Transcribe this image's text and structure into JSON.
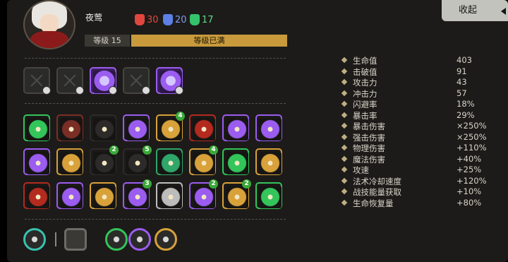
{
  "character": {
    "name": "夜莺"
  },
  "resources": [
    {
      "value": "30",
      "color": "#e0463e"
    },
    {
      "value": "20",
      "color": "#5d7fe6"
    },
    {
      "value": "17",
      "color": "#34c26a"
    }
  ],
  "level": {
    "label": "等级 15",
    "status": "等级已满",
    "progress": 1.0
  },
  "collapse_button": {
    "label": "收起"
  },
  "equipment": [
    {
      "icon": "empty-slot-icon",
      "accent": "#45443f",
      "state": "empty"
    },
    {
      "icon": "empty-slot-icon",
      "accent": "#45443f",
      "state": "empty"
    },
    {
      "icon": "purple-gem-mask-icon",
      "accent": "#9b5cf0",
      "state": "filled"
    },
    {
      "icon": "empty-slot-icon",
      "accent": "#45443f",
      "state": "empty"
    },
    {
      "icon": "armor-vest-icon",
      "accent": "#9b5cf0",
      "state": "filled"
    }
  ],
  "talents": [
    {
      "icon": "starburst-icon",
      "accent": "#33c55a",
      "badge": ""
    },
    {
      "icon": "winged-demon-icon",
      "accent": "#7a2e26",
      "badge": ""
    },
    {
      "icon": "mortar-icon",
      "accent": "#2c2b29",
      "badge": ""
    },
    {
      "icon": "purple-spikes-icon",
      "accent": "#9b5cf0",
      "badge": ""
    },
    {
      "icon": "lightning-tree-icon",
      "accent": "#d8a13a",
      "badge": "4"
    },
    {
      "icon": "red-demon-icon",
      "accent": "#b32a1f",
      "badge": ""
    },
    {
      "icon": "w-emblem-icon",
      "accent": "#9b5cf0",
      "badge": ""
    },
    {
      "icon": "purple-claw-icon",
      "accent": "#9b5cf0",
      "badge": ""
    },
    {
      "icon": "purple-curve-icon",
      "accent": "#9b5cf0",
      "badge": ""
    },
    {
      "icon": "gold-gear-icon",
      "accent": "#d8a13a",
      "badge": ""
    },
    {
      "icon": "dark-shield-icon",
      "accent": "#2c2b29",
      "badge": "2"
    },
    {
      "icon": "yellow-skull-icon",
      "accent": "#2c2b29",
      "badge": "5"
    },
    {
      "icon": "green-grass-icon",
      "accent": "#2fa66a",
      "badge": ""
    },
    {
      "icon": "sunrise-icon",
      "accent": "#d8a13a",
      "badge": "4"
    },
    {
      "icon": "green-arrow-up-icon",
      "accent": "#33c55a",
      "badge": ""
    },
    {
      "icon": "gold-crown-icon",
      "accent": "#d8a13a",
      "badge": ""
    },
    {
      "icon": "barcode-box-icon",
      "accent": "#b32a1f",
      "badge": ""
    },
    {
      "icon": "purple-feather-icon",
      "accent": "#9b5cf0",
      "badge": ""
    },
    {
      "icon": "circuit-icon",
      "accent": "#d8a13a",
      "badge": ""
    },
    {
      "icon": "stairs-icon",
      "accent": "#9b5cf0",
      "badge": "3"
    },
    {
      "icon": "cog-disc-icon",
      "accent": "#bcbcbc",
      "badge": ""
    },
    {
      "icon": "tower-icon",
      "accent": "#9b5cf0",
      "badge": "2"
    },
    {
      "icon": "orange-ring-icon",
      "accent": "#d8a13a",
      "badge": "2"
    },
    {
      "icon": "swords-icon",
      "accent": "#33c55a",
      "badge": ""
    }
  ],
  "bottom_bar": [
    {
      "icon": "hex-gem-icon",
      "accent": "#3ac1b0"
    },
    {
      "icon": "pistol-icon",
      "accent": "#6d6b66"
    },
    {
      "icon": "green-diamond-ring-icon",
      "accent": "#33c55a"
    },
    {
      "icon": "purple-diamond-ring-icon",
      "accent": "#9b5cf0"
    },
    {
      "icon": "gold-drops-icon",
      "accent": "#d8a13a"
    }
  ],
  "stats": [
    {
      "label": "生命值",
      "value": "403"
    },
    {
      "label": "击破值",
      "value": "91"
    },
    {
      "label": "攻击力",
      "value": "43"
    },
    {
      "label": "冲击力",
      "value": "57"
    },
    {
      "label": "闪避率",
      "value": "18%"
    },
    {
      "label": "暴击率",
      "value": "29%"
    },
    {
      "label": "暴击伤害",
      "value": "×250%"
    },
    {
      "label": "强击伤害",
      "value": "×250%"
    },
    {
      "label": "物理伤害",
      "value": "+110%"
    },
    {
      "label": "魔法伤害",
      "value": "+40%"
    },
    {
      "label": "攻速",
      "value": "+25%"
    },
    {
      "label": "法术冷却速度",
      "value": "+120%"
    },
    {
      "label": "战技能量获取",
      "value": "+10%"
    },
    {
      "label": "生命恢复量",
      "value": "+80%"
    }
  ]
}
